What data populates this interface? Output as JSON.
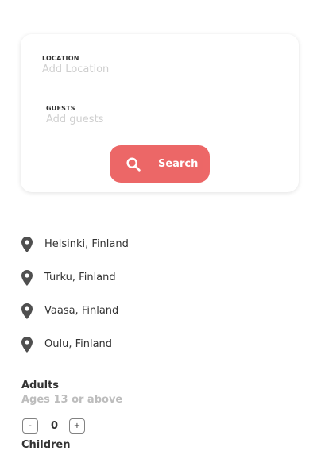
{
  "search_card": {
    "location": {
      "label": "LOCATION",
      "placeholder": "Add Location",
      "value": ""
    },
    "guests": {
      "label": "GUESTS",
      "placeholder": "Add guests",
      "value": ""
    },
    "search_button": {
      "label": "Search",
      "icon": "search-icon"
    }
  },
  "locations": [
    {
      "label": "Helsinki, Finland",
      "icon": "location-pin-icon"
    },
    {
      "label": "Turku, Finland",
      "icon": "location-pin-icon"
    },
    {
      "label": "Vaasa, Finland",
      "icon": "location-pin-icon"
    },
    {
      "label": "Oulu, Finland",
      "icon": "location-pin-icon"
    }
  ],
  "guests_panel": {
    "adults": {
      "title": "Adults",
      "subtitle": "Ages 13 or above",
      "count": "0",
      "minus": "-",
      "plus": "+"
    },
    "children": {
      "title": "Children"
    }
  },
  "colors": {
    "accent": "#EB5757",
    "text": "#333333",
    "placeholder": "#BDBDBD",
    "pin": "#4F4F4F"
  }
}
